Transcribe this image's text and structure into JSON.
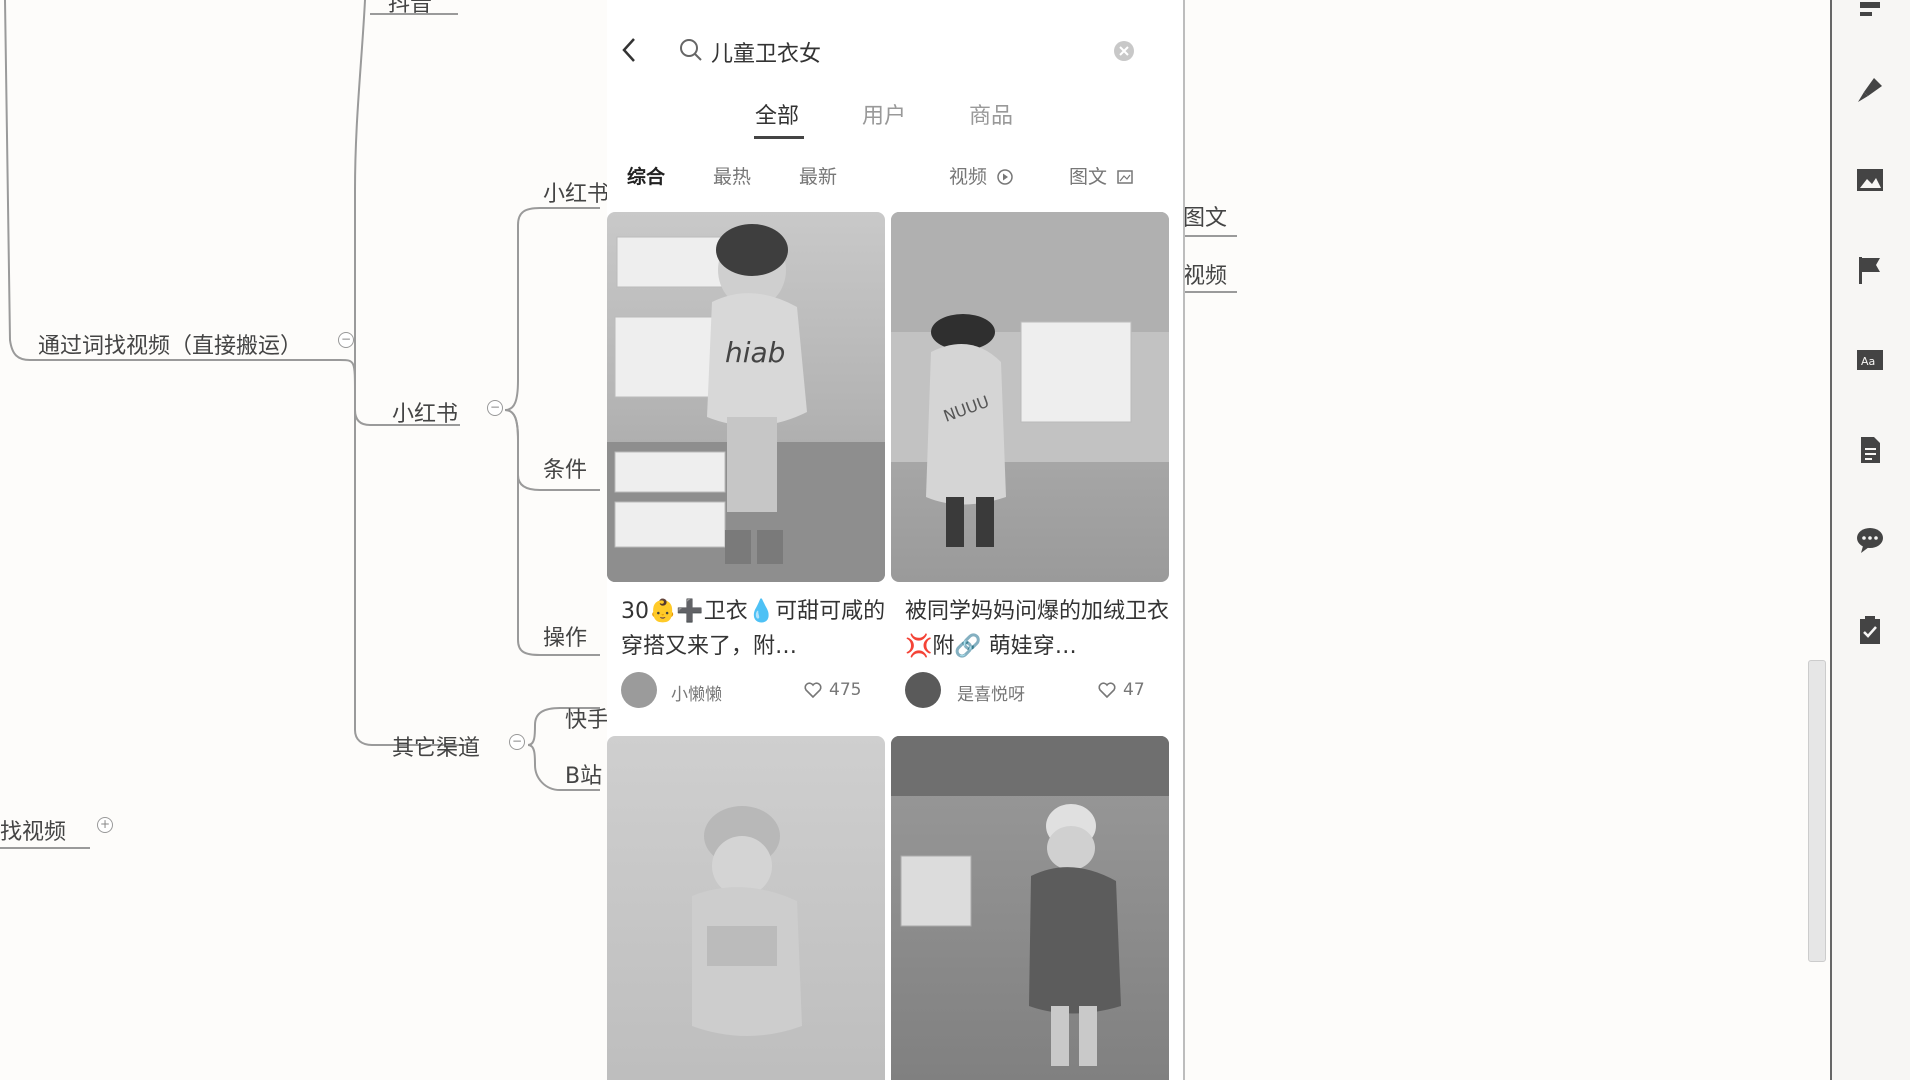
{
  "mindmap": {
    "nodes": {
      "node_top_partial": "抖音",
      "via_word": "通过词找视频（直接搬运）",
      "xiaohongshu": "小红书",
      "xiaohongshu_child": "小红书",
      "conditions": "条件",
      "operations": "操作",
      "other_channels": "其它渠道",
      "kuaishou": "快手",
      "bilibili": "B站",
      "find_video": "找视频",
      "tuwen": "图文",
      "shipin": "视频"
    }
  },
  "phone": {
    "search": {
      "back_icon": "back-arrow",
      "query": "儿童卫衣女",
      "search_icon": "search-icon",
      "clear_icon": "clear-icon"
    },
    "tabs": [
      {
        "label": "全部",
        "active": true
      },
      {
        "label": "用户",
        "active": false
      },
      {
        "label": "商品",
        "active": false
      }
    ],
    "filters": {
      "composite": "综合",
      "hot": "最热",
      "new": "最新",
      "video": "视频",
      "tuwen": "图文"
    },
    "cards": [
      {
        "title": "30👶➕卫衣💧可甜可咸的穿搭又来了，附…",
        "author": "小懒懒",
        "likes": "475"
      },
      {
        "title": "被同学妈妈问爆的加绒卫衣💢附🔗 萌娃穿…",
        "author": "是喜悦呀",
        "likes": "47"
      }
    ]
  },
  "colors": {
    "bg": "#fdfcfa",
    "accent": "#444444",
    "line": "#9a9a9a"
  },
  "rail_icons": [
    "brush-icon",
    "image-icon",
    "flag-icon",
    "text-style-icon",
    "document-icon",
    "comment-icon",
    "clipboard-icon"
  ]
}
